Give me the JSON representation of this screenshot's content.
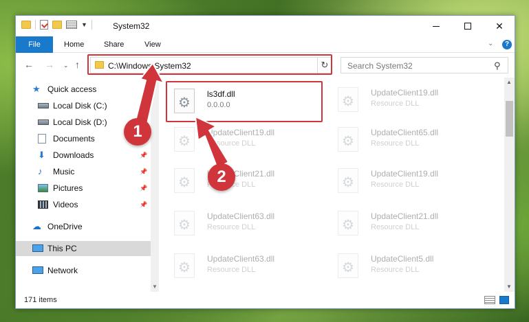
{
  "window": {
    "title": "System32",
    "minimize_glyph": "",
    "close_glyph": "✕"
  },
  "ribbon": {
    "tabs": [
      {
        "label": "File"
      },
      {
        "label": "Home"
      },
      {
        "label": "Share"
      },
      {
        "label": "View"
      }
    ],
    "expand_glyph": "⌄",
    "help_glyph": "?"
  },
  "address": {
    "path": "C:\\Windows\\System32",
    "search_placeholder": "Search System32"
  },
  "nav": {
    "items": [
      {
        "label": "Quick access",
        "icon": "star-icon"
      },
      {
        "label": "Local Disk (C:)",
        "icon": "disk-icon"
      },
      {
        "label": "Local Disk (D:)",
        "icon": "disk-icon"
      },
      {
        "label": "Documents",
        "icon": "document-icon"
      },
      {
        "label": "Downloads",
        "icon": "download-icon",
        "pinned": true
      },
      {
        "label": "Music",
        "icon": "music-icon",
        "pinned": true
      },
      {
        "label": "Pictures",
        "icon": "picture-icon",
        "pinned": true
      },
      {
        "label": "Videos",
        "icon": "video-icon",
        "pinned": true
      },
      {
        "label": "OneDrive",
        "icon": "cloud-icon"
      },
      {
        "label": "This PC",
        "icon": "computer-icon",
        "selected": true
      },
      {
        "label": "Network",
        "icon": "network-icon"
      }
    ]
  },
  "files": {
    "left": [
      {
        "name": "ls3df.dll",
        "sub": "0.0.0.0"
      },
      {
        "name": "UpdateClient19.dll",
        "sub": "Resource DLL"
      },
      {
        "name": "UpdateClient21.dll",
        "sub": "Resource DLL"
      },
      {
        "name": "UpdateClient63.dll",
        "sub": "Resource DLL"
      },
      {
        "name": "UpdateClient63.dll",
        "sub": "Resource DLL"
      }
    ],
    "right": [
      {
        "name": "UpdateClient19.dll",
        "sub": "Resource DLL"
      },
      {
        "name": "UpdateClient65.dll",
        "sub": "Resource DLL"
      },
      {
        "name": "UpdateClient19.dll",
        "sub": "Resource DLL"
      },
      {
        "name": "UpdateClient21.dll",
        "sub": "Resource DLL"
      },
      {
        "name": "UpdateClient5.dll",
        "sub": "Resource DLL"
      }
    ]
  },
  "status": {
    "item_count": "171 items"
  },
  "callouts": {
    "one": "1",
    "two": "2"
  },
  "colors": {
    "accent": "#1979ca",
    "highlight": "#d0353b"
  }
}
